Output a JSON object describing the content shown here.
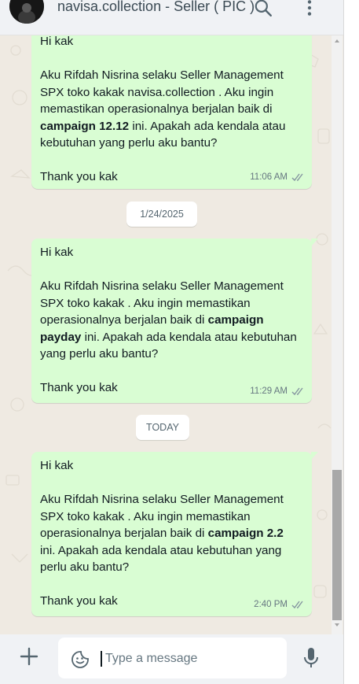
{
  "header": {
    "title": "navisa.collection - Seller ( PIC )",
    "icons": [
      "search-icon",
      "more-vertical-icon"
    ]
  },
  "messages": [
    {
      "greeting": "Hi kak",
      "lines": [
        [
          "Aku Rifdah Nisrina selaku Seller Management"
        ],
        [
          "SPX toko kakak navisa.collection . Aku ingin"
        ],
        [
          "memastikan operasionalnya berjalan baik di"
        ],
        [
          "campaign 12.12",
          " ini. Apakah ada kendala atau"
        ],
        [
          "kebutuhan yang perlu aku bantu?"
        ]
      ],
      "closing": "Thank you kak",
      "time": "11:06 AM",
      "status": "read-double-check"
    },
    {
      "greeting": "Hi kak",
      "lines": [
        [
          "Aku Rifdah Nisrina selaku Seller Management"
        ],
        [
          "SPX toko kakak . Aku ingin memastikan"
        ],
        [
          "operasionalnya berjalan baik di ",
          "campaign"
        ],
        [
          "payday",
          " ini. Apakah ada kendala atau kebutuhan"
        ],
        [
          "yang perlu aku bantu?"
        ]
      ],
      "closing": "Thank you kak",
      "time": "11:29 AM",
      "status": "read-double-check"
    },
    {
      "greeting": "Hi kak",
      "lines": [
        [
          "Aku Rifdah Nisrina selaku Seller Management"
        ],
        [
          "SPX toko kakak . Aku ingin memastikan"
        ],
        [
          "operasionalnya berjalan baik di ",
          "campaign 2.2"
        ],
        [
          "ini. Apakah ada kendala atau kebutuhan yang"
        ],
        [
          "perlu aku bantu?"
        ]
      ],
      "closing": "Thank you kak",
      "time": "2:40 PM",
      "status": "read-double-check"
    }
  ],
  "date_separators": [
    "1/24/2025",
    "TODAY"
  ],
  "composer": {
    "placeholder": "Type a message",
    "icons": [
      "plus-icon",
      "emoji-icon",
      "microphone-icon"
    ]
  },
  "colors": {
    "outgoing_bubble": "#d9fdd3",
    "chat_background": "#efeae2",
    "panel": "#f0f2f5",
    "tick": "#8696a0"
  }
}
